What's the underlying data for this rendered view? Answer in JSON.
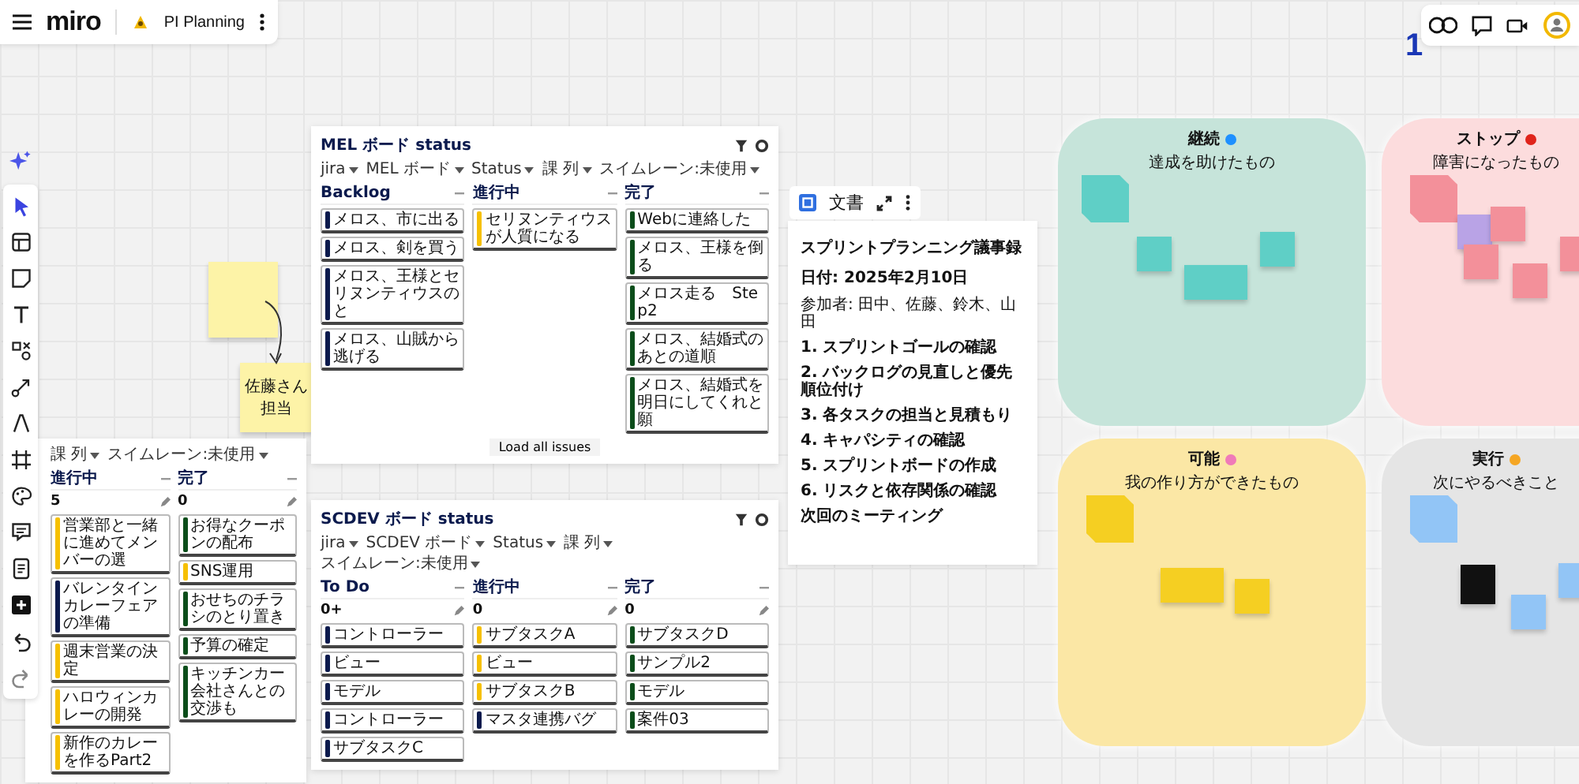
{
  "topbar": {
    "logo": "miro",
    "board_name": "PI Planning"
  },
  "counter": "1",
  "stickies": [
    {
      "kind": "blank",
      "color": "#fdf3a7"
    },
    {
      "kind": "text",
      "color": "#fdf3a7",
      "text": "佐藤さん担当"
    }
  ],
  "boards": [
    {
      "title": "MEL ボード status",
      "filters": [
        "jira",
        "MEL ボード",
        "Status",
        "課 列",
        "スイムレーン:未使用"
      ],
      "load_button": "Load all issues",
      "columns": [
        {
          "name": "Backlog",
          "cards": [
            {
              "text": "メロス、市に出る",
              "color": "#0b1a4d"
            },
            {
              "text": "メロス、剣を買う",
              "color": "#0b1a4d"
            },
            {
              "text": "メロス、王様とセリヌンティウスのと",
              "color": "#0b1a4d"
            },
            {
              "text": "メロス、山賊から逃げる",
              "color": "#0b1a4d"
            }
          ]
        },
        {
          "name": "進行中",
          "cards": [
            {
              "text": "セリヌンティウスが人質になる",
              "color": "#f6c000"
            }
          ]
        },
        {
          "name": "完了",
          "cards": [
            {
              "text": "Webに連絡した",
              "color": "#0b4d1a"
            },
            {
              "text": "メロス、王様を倒る",
              "color": "#0b4d1a"
            },
            {
              "text": "メロス走る　Step2",
              "color": "#0b4d1a"
            },
            {
              "text": "メロス、結婚式のあとの道順",
              "color": "#0b4d1a"
            },
            {
              "text": "メロス、結婚式を明日にしてくれと願",
              "color": "#0b4d1a"
            }
          ]
        }
      ]
    },
    {
      "filters": [
        "課 列",
        "スイムレーン:未使用"
      ],
      "columns": [
        {
          "name": "進行中",
          "stat": "5",
          "cards": [
            {
              "text": "営業部と一緒に進めてメンバーの選",
              "color": "#f6c000"
            },
            {
              "text": "バレンタインカレーフェアの準備",
              "color": "#0b1a4d"
            },
            {
              "text": "週末営業の決定",
              "color": "#f6c000"
            },
            {
              "text": "ハロウィンカレーの開発",
              "color": "#f6c000"
            },
            {
              "text": "新作のカレーを作るPart2",
              "color": "#f6c000"
            }
          ]
        },
        {
          "name": "完了",
          "stat": "0",
          "cards": [
            {
              "text": "お得なクーポンの配布",
              "color": "#0b4d1a"
            },
            {
              "text": "SNS運用",
              "color": "#f6c000"
            },
            {
              "text": "おせちのチラシのとり置き",
              "color": "#0b4d1a"
            },
            {
              "text": "予算の確定",
              "color": "#0b4d1a"
            },
            {
              "text": "キッチンカー会社さんとの交渉も",
              "color": "#0b4d1a"
            }
          ]
        }
      ]
    },
    {
      "title": "SCDEV ボード status",
      "filters": [
        "jira",
        "SCDEV ボード",
        "Status",
        "課 列",
        "スイムレーン:未使用"
      ],
      "columns": [
        {
          "name": "To Do",
          "stat": "0+",
          "cards": [
            {
              "text": "コントローラー",
              "color": "#0b1a4d"
            },
            {
              "text": "ビュー",
              "color": "#0b1a4d"
            },
            {
              "text": "モデル",
              "color": "#0b1a4d"
            },
            {
              "text": "コントローラー",
              "color": "#0b1a4d"
            },
            {
              "text": "サブタスクC",
              "color": "#0b1a4d"
            }
          ]
        },
        {
          "name": "進行中",
          "stat": "0",
          "cards": [
            {
              "text": "サブタスクA",
              "color": "#f6c000"
            },
            {
              "text": "ビュー",
              "color": "#f6c000"
            },
            {
              "text": "サブタスクB",
              "color": "#f6c000"
            },
            {
              "text": "マスタ連携バグ",
              "color": "#0b1a4d"
            }
          ]
        },
        {
          "name": "完了",
          "stat": "0",
          "cards": [
            {
              "text": "サブタスクD",
              "color": "#0b4d1a"
            },
            {
              "text": "サンプル2",
              "color": "#0b4d1a"
            },
            {
              "text": "モデル",
              "color": "#0b4d1a"
            },
            {
              "text": "案件03",
              "color": "#0b4d1a"
            }
          ]
        }
      ]
    }
  ],
  "document": {
    "label": "文書",
    "lines": [
      {
        "kind": "title",
        "text": "スプリントプランニング議事録"
      },
      {
        "kind": "subtitle",
        "text": "日付: 2025年2月10日"
      },
      {
        "kind": "meta",
        "text": "参加者: 田中、佐藤、鈴木、山田"
      },
      {
        "kind": "heading",
        "text": "1. スプリントゴールの確認"
      },
      {
        "kind": "heading",
        "text": "2. バックログの見直しと優先順位付け"
      },
      {
        "kind": "heading",
        "text": "3. 各タスクの担当と見積もり"
      },
      {
        "kind": "heading",
        "text": "4. キャパシティの確認"
      },
      {
        "kind": "heading",
        "text": "5. スプリントボードの作成"
      },
      {
        "kind": "heading",
        "text": "6. リスクと依存関係の確認"
      },
      {
        "kind": "heading",
        "text": "次回のミーティング"
      }
    ]
  },
  "quadrants": [
    {
      "title": "継続",
      "subtitle": "達成を助けたもの",
      "color": "#c6e4da",
      "notes": [
        {
          "color": "#5fcfc6"
        },
        {
          "color": "#5fcfc6"
        },
        {
          "color": "#5fcfc6"
        },
        {
          "color": "#5fcfc6"
        }
      ]
    },
    {
      "title": "ストップ",
      "subtitle": "障害になったもの",
      "color": "#fcdcdd",
      "notes": [
        {
          "color": "#f3909a"
        },
        {
          "color": "#b9a3e6"
        },
        {
          "color": "#f3909a"
        },
        {
          "color": "#f3909a"
        },
        {
          "color": "#f3909a"
        },
        {
          "color": "#f3909a"
        }
      ]
    },
    {
      "title": "可能",
      "subtitle": "我の作り方ができたもの",
      "color": "#fbe7a5",
      "notes": [
        {
          "color": "#f5cf22"
        },
        {
          "color": "#f5cf22"
        },
        {
          "color": "#f5cf22"
        }
      ]
    },
    {
      "title": "実行",
      "subtitle": "次にやるべきこと",
      "color": "#e5e5e5",
      "notes": [
        {
          "color": "#92c5f6"
        },
        {
          "color": "#111111"
        },
        {
          "color": "#92c5f6"
        },
        {
          "color": "#92c5f6"
        }
      ]
    }
  ]
}
